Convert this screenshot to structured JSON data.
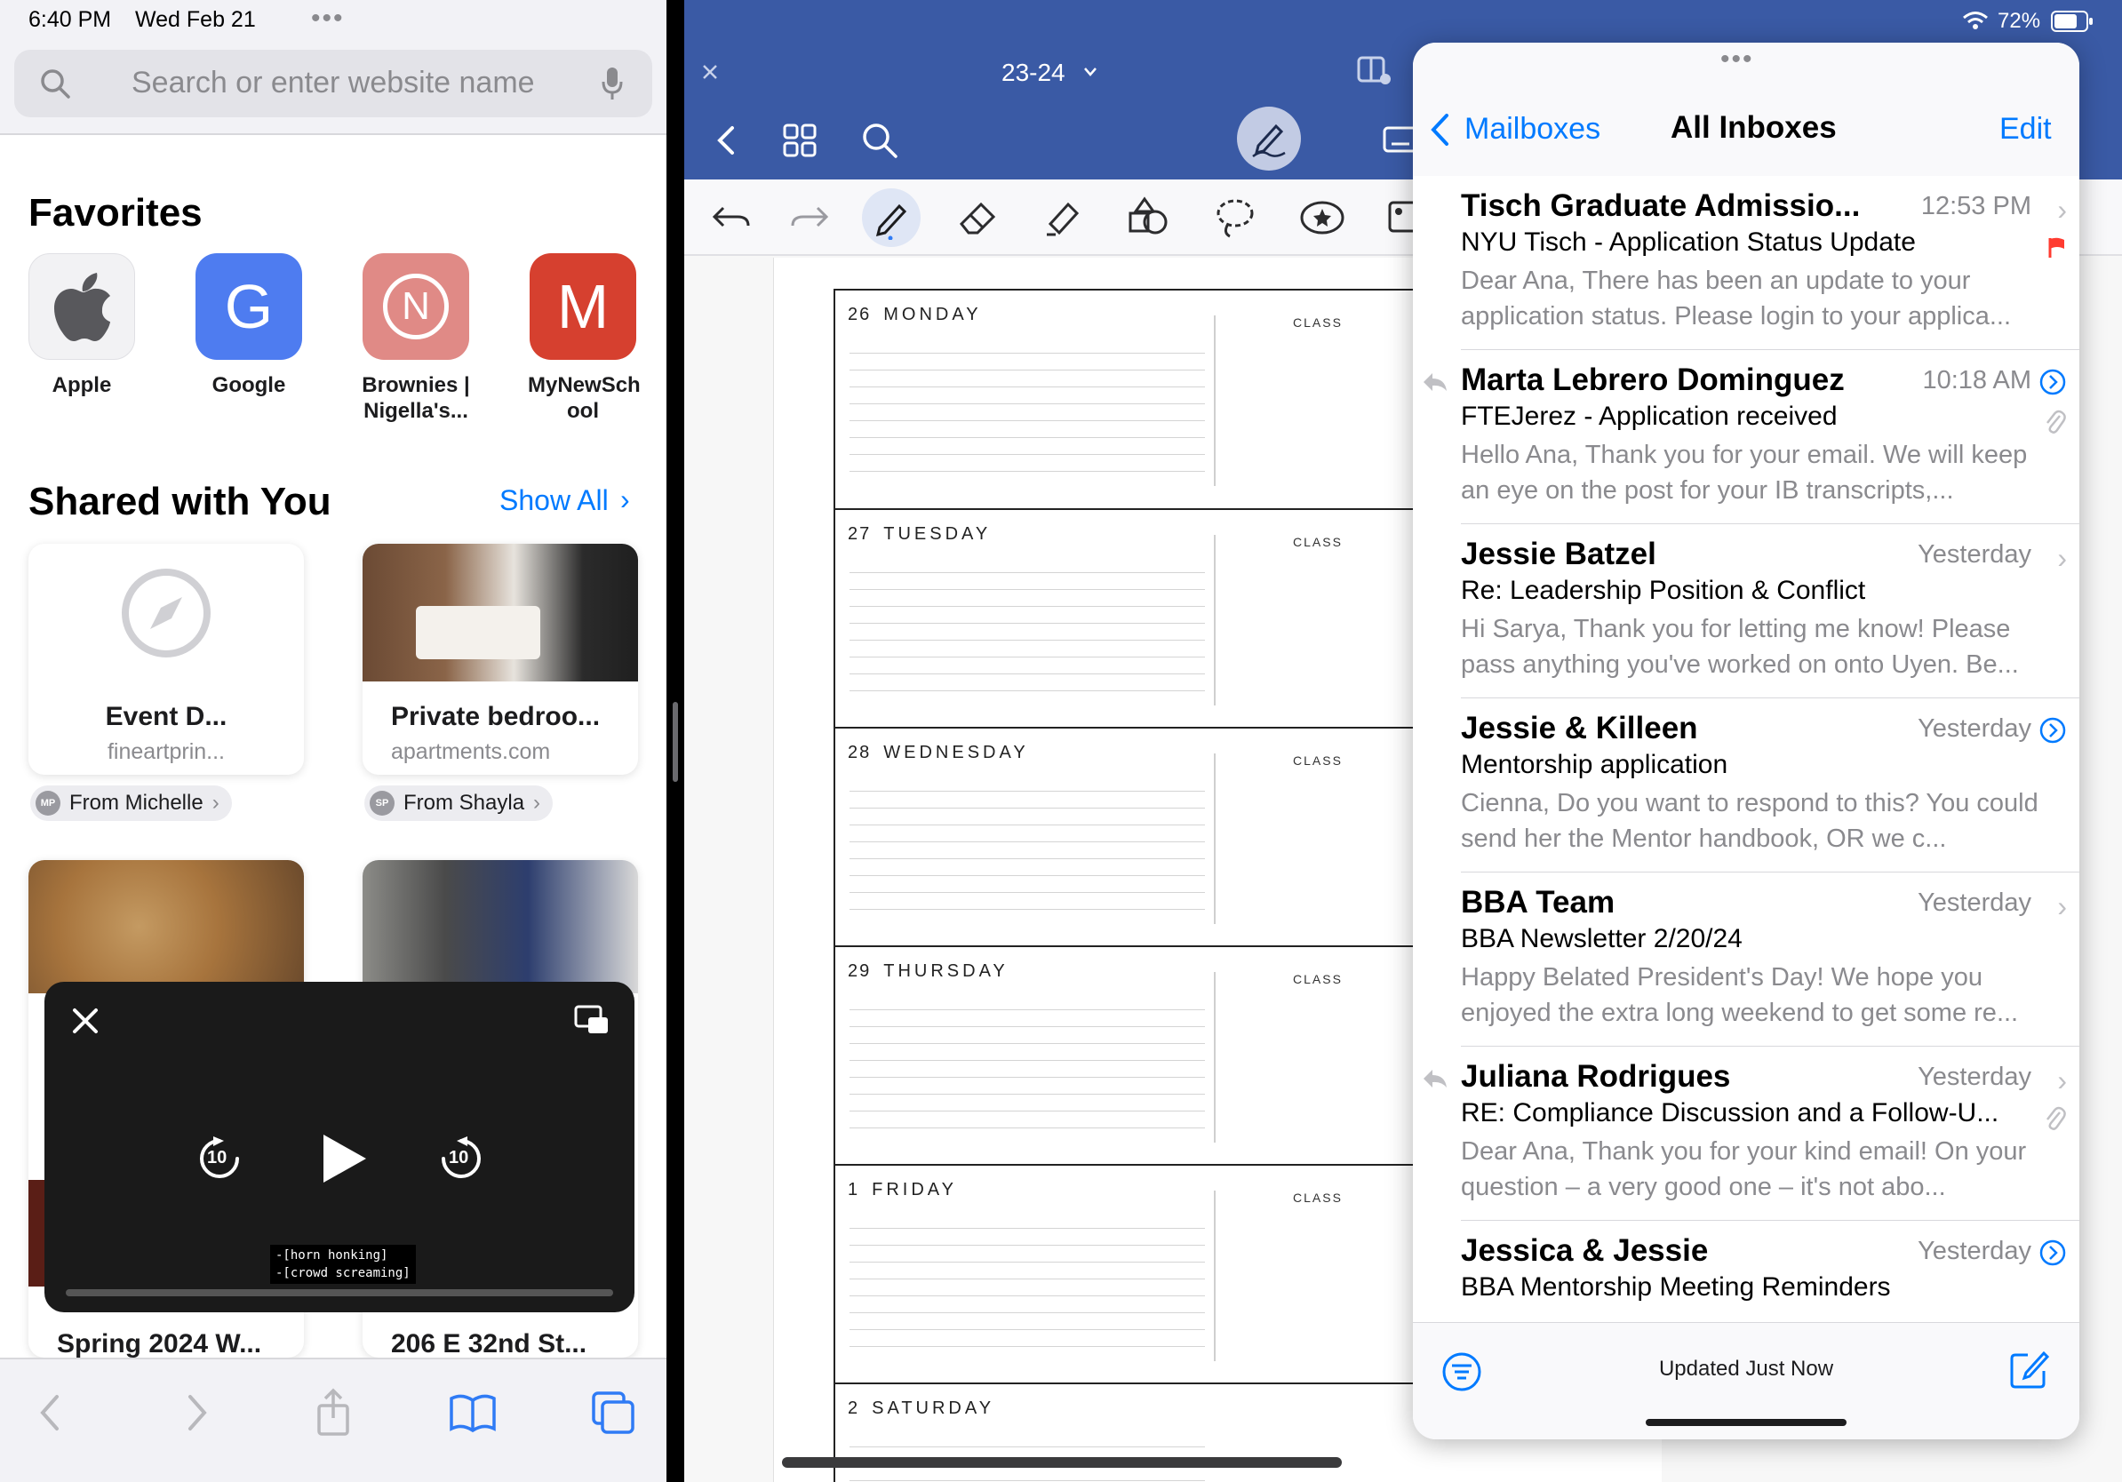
{
  "status": {
    "time": "6:40 PM",
    "date": "Wed Feb 21",
    "battery": "72%"
  },
  "safari": {
    "search_placeholder": "Search or enter website name",
    "favorites_title": "Favorites",
    "favorites": [
      {
        "label": "Apple"
      },
      {
        "label": "Google",
        "glyph": "G"
      },
      {
        "label": "Brownies | Nigella's...",
        "glyph": "N"
      },
      {
        "label": "MyNewSch ool",
        "glyph": "M"
      }
    ],
    "shared_title": "Shared with You",
    "show_all": "Show All",
    "cards": [
      {
        "title": "Event D...",
        "sub": "fineartprin...",
        "from": "From Michelle",
        "initials": "MP"
      },
      {
        "title": "Private bedroo...",
        "sub": "apartments.com",
        "from": "From Shayla",
        "initials": "SP"
      }
    ],
    "lower_cards": [
      {
        "title": "Spring 2024 W..."
      },
      {
        "title": "206 E 32nd St..."
      }
    ],
    "pip": {
      "caption_1": "-[horn honking]",
      "caption_2": "-[crowd screaming]",
      "skip": "10"
    }
  },
  "notes": {
    "doc_title": "23-24",
    "class_label": "CLASS",
    "days": [
      {
        "num": "26",
        "name": "MONDAY"
      },
      {
        "num": "27",
        "name": "TUESDAY"
      },
      {
        "num": "28",
        "name": "WEDNESDAY"
      },
      {
        "num": "29",
        "name": "THURSDAY"
      },
      {
        "num": "1",
        "name": "FRIDAY"
      },
      {
        "num": "2",
        "name": "SATURDAY"
      }
    ]
  },
  "mail": {
    "back_label": "Mailboxes",
    "title": "All Inboxes",
    "edit_label": "Edit",
    "footer_status": "Updated Just Now",
    "messages": [
      {
        "sender": "Tisch Graduate Admissio...",
        "time": "12:53 PM",
        "subject": "NYU Tisch - Application Status Update",
        "preview": "Dear Ana, There has been an update to your application status. Please login to your applica..."
      },
      {
        "sender": "Marta Lebrero Dominguez",
        "time": "10:18 AM",
        "subject": "FTEJerez - Application received",
        "preview": "Hello Ana, Thank you for your email. We will keep an eye on the post for your IB transcripts,..."
      },
      {
        "sender": "Jessie Batzel",
        "time": "Yesterday",
        "subject": "Re: Leadership Position & Conflict",
        "preview": "Hi Sarya, Thank you for letting me know! Please pass anything you've worked on onto Uyen. Be..."
      },
      {
        "sender": "Jessie & Killeen",
        "time": "Yesterday",
        "subject": "Mentorship application",
        "preview": "Cienna, Do you want to respond to this? You could send her the Mentor handbook, OR we c..."
      },
      {
        "sender": "BBA Team",
        "time": "Yesterday",
        "subject": "BBA Newsletter 2/20/24",
        "preview": "Happy Belated President's Day! We hope you enjoyed the extra long weekend to get some re..."
      },
      {
        "sender": "Juliana Rodrigues",
        "time": "Yesterday",
        "subject": "RE: Compliance Discussion and a Follow-U...",
        "preview": "Dear Ana, Thank you for your kind email! On your question – a very good one – it's not abo..."
      },
      {
        "sender": "Jessica & Jessie",
        "time": "Yesterday",
        "subject": "BBA Mentorship Meeting Reminders",
        "preview": ""
      }
    ]
  },
  "colors": {
    "accent": "#007aff",
    "notes_header": "#3a5aa5",
    "flag": "#ff3b30"
  }
}
